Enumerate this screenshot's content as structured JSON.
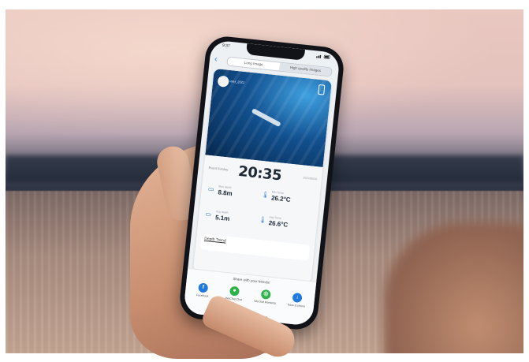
{
  "phone": {
    "status_time": "9:37",
    "segments": [
      "Long Image",
      "High quality Images"
    ],
    "selected_segment": 1,
    "card": {
      "user": "user_2021",
      "date_label": "Event Sunday",
      "dive_time": "20:35",
      "date_right": "2021/06/20",
      "stats": [
        {
          "icon": "depth-icon",
          "label": "Max depth",
          "value": "8.8m"
        },
        {
          "icon": "thermometer-icon",
          "label": "Min Temp",
          "value": "26.2°C"
        },
        {
          "icon": "depth-icon",
          "label": "Avg depth",
          "value": "5.1m"
        },
        {
          "icon": "thermometer-icon",
          "label": "Avg Temp",
          "value": "26.6°C"
        }
      ],
      "trend_label": "Depth Trend"
    },
    "share": {
      "title": "Share with your friends!",
      "items": [
        {
          "label": "Facebook",
          "icon": "facebook-icon",
          "color": "#1f7ae0",
          "glyph": "f"
        },
        {
          "label": "WeChat Chat",
          "icon": "wechat-icon",
          "color": "#2fb24a",
          "glyph": "●"
        },
        {
          "label": "WeChat Moments",
          "icon": "moments-icon",
          "color": "#2fb24a",
          "glyph": "◎"
        },
        {
          "label": "Save to phone",
          "icon": "download-icon",
          "color": "#1f7ae0",
          "glyph": "↓"
        }
      ]
    }
  }
}
